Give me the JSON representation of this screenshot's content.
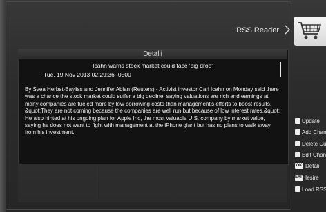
{
  "header": {
    "title": "RSS Reader",
    "icon": "shopping-cart-icon"
  },
  "detail": {
    "heading": "Detalii",
    "article_title": "Icahn warns stock market could face 'big drop'",
    "article_date": "Tue, 19 Nov 2013 02:29:36 -0500",
    "article_body": "By Svea Herbst-Bayliss and Jennifer Ablan (Reuters) - Activist investor Carl Icahn on Monday said there was a chance the stock market could suffer a big decline, saying valuations are rich and earnings at many companies are fueled more by low borrowing costs than management's efforts to boost results. &quot;They are not coming because the companies are well run but because of low interest rates.&quot; He also hinted at his ongoing plan for Apple Inc, the most valuable U.S. company by market value, saying he does not want to fight with management at the iPhone giant but has no plans to walk away from his investment."
  },
  "legend": {
    "update": "Update",
    "add": "Add Chan",
    "delete": "Delete Cu",
    "edit": "Edit Chan",
    "ok_key": "OK",
    "ok_label": "Detalii",
    "exit_key": "EXIT",
    "exit_label": "Iesire",
    "load": "Load RSS"
  },
  "colors": {
    "background": "#2a2a2a",
    "panel": "#121212",
    "text": "#f0f0f0"
  }
}
